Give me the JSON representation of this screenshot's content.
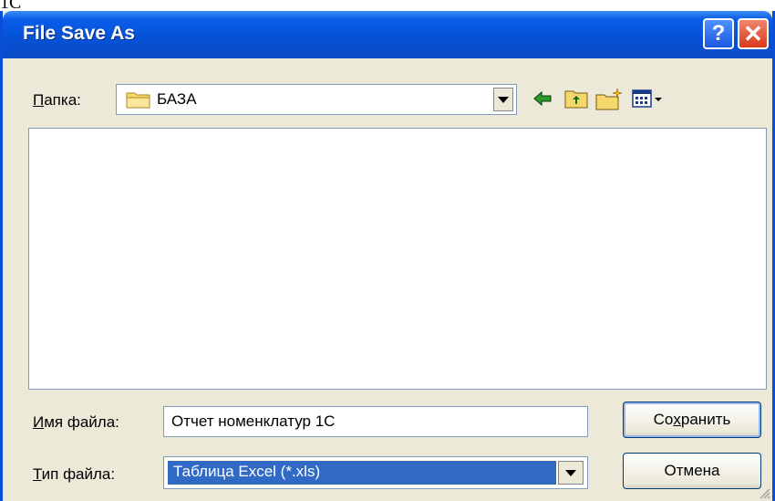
{
  "page_fragment": "1C",
  "window": {
    "title": "File Save As",
    "help_glyph": "?",
    "close_glyph": "✕"
  },
  "folder": {
    "label_hotkey": "П",
    "label_rest": "апка:",
    "current": "БАЗА",
    "icons": [
      "folder-icon",
      "back-arrow-icon",
      "up-folder-icon",
      "new-folder-icon",
      "view-menu-icon"
    ]
  },
  "filename": {
    "label_hotkey": "И",
    "label_rest": "мя файла:",
    "value": "Отчет номенклатур 1С"
  },
  "filetype": {
    "label_hotkey": "Т",
    "label_rest": "ип файла:",
    "selected": "Таблица Excel (*.xls)"
  },
  "buttons": {
    "save_pre": "Со",
    "save_hotkey": "х",
    "save_post": "ранить",
    "cancel": "Отмена"
  },
  "colors": {
    "titlebar": "#0a5ce8",
    "dialog_bg": "#ece9d8",
    "selection": "#316ac5"
  }
}
